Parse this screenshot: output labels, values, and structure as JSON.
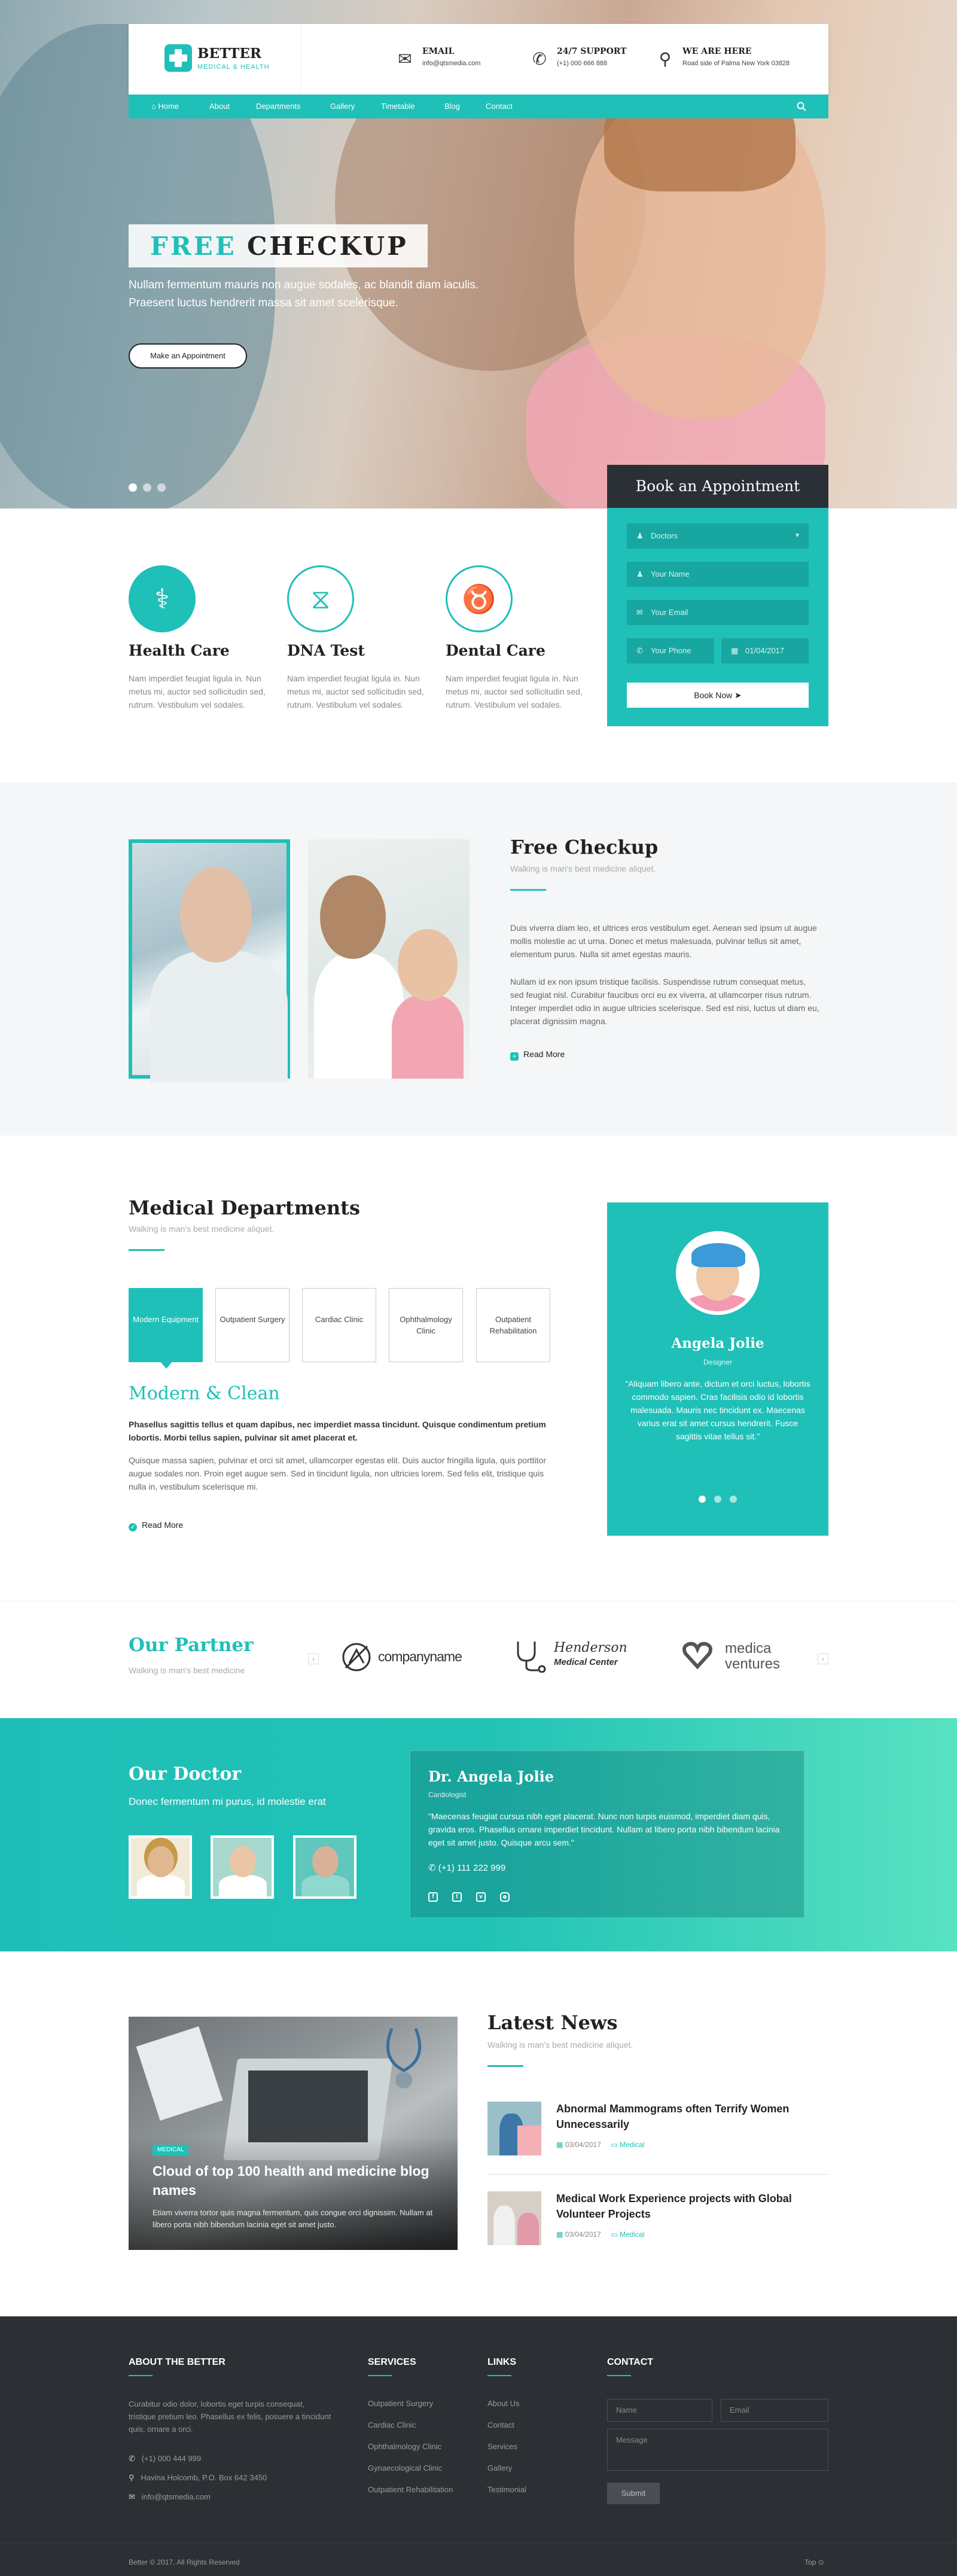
{
  "brand": {
    "name": "BETTER",
    "tagline": "MEDICAL & HEALTH"
  },
  "header_info": [
    {
      "icon": "envelope-icon",
      "glyph": "✉",
      "title": "EMAIL",
      "sub": "info@qtsmedia.com"
    },
    {
      "icon": "phone-icon",
      "glyph": "✆",
      "title": "24/7 SUPPORT",
      "sub": "(+1) 000 666 888"
    },
    {
      "icon": "map-pin-icon",
      "glyph": "⚲",
      "title": "WE ARE HERE",
      "sub": "Road side of Palma New York 03828"
    }
  ],
  "nav": {
    "items": [
      {
        "label": "Home",
        "icon": "⌂"
      },
      {
        "label": "About"
      },
      {
        "label": "Departments"
      },
      {
        "label": "Gallery"
      },
      {
        "label": "Timetable"
      },
      {
        "label": "Blog"
      },
      {
        "label": "Contact"
      }
    ],
    "search_icon": "search-icon"
  },
  "hero": {
    "title_accent": "FREE",
    "title_rest": "CHECKUP",
    "desc": "Nullam fermentum mauris non augue sodales, ac blandit diam iaculis. Praesent luctus hendrerit massa sit amet scelerisque.",
    "button": "Make an Appointment"
  },
  "appointment": {
    "title": "Book an Appointment",
    "doctors": "Doctors",
    "name_ph": "Your Name",
    "email_ph": "Your Email",
    "phone_ph": "Your Phone",
    "date": "01/04/2017",
    "button": "Book Now"
  },
  "services": [
    {
      "title": "Health Care",
      "icon": "stethoscope-icon",
      "desc": "Nam imperdiet feugiat ligula in. Nun metus mi, auctor sed sollicitudin sed, rutrum. Vestibulum vel sodales."
    },
    {
      "title": "DNA Test",
      "icon": "dna-icon",
      "desc": "Nam imperdiet feugiat ligula in. Nun metus mi, auctor sed sollicitudin sed, rutrum. Vestibulum vel sodales."
    },
    {
      "title": "Dental Care",
      "icon": "tooth-icon",
      "desc": "Nam imperdiet feugiat ligula in. Nun metus mi, auctor sed sollicitudin sed, rutrum. Vestibulum vel sodales."
    }
  ],
  "checkup": {
    "title": "Free Checkup",
    "sub": "Walking is man's best medicine aliquet.",
    "p1": "Duis viverra diam leo, et ultrices eros vestibulum eget. Aenean sed ipsum ut augue mollis molestie ac ut urna. Donec et metus malesuada, pulvinar tellus sit amet, elementum purus. Nulla sit amet egestas mauris.",
    "p2": "Nullam id ex non ipsum tristique facilisis. Suspendisse rutrum consequat metus, sed feugiat nisl. Curabitur faucibus orci eu ex viverra, at ullamcorper risus rutrum. Integer imperdiet odio in augue ultricies scelerisque. Sed est nisi, luctus ut diam eu, placerat dignissim magna.",
    "more": "Read More"
  },
  "departments": {
    "title": "Medical Departments",
    "sub": "Walking is man's best medicine aliquet.",
    "tabs": [
      "Modern Equipment",
      "Outpatient Surgery",
      "Cardiac Clinic",
      "Ophthalmology Clinic",
      "Outpatient Rehabilitation"
    ],
    "content_title": "Modern & Clean",
    "bold": "Phasellus sagittis tellus et quam dapibus, nec imperdiet massa tincidunt. Quisque condimentum pretium lobortis. Morbi tellus sapien, pulvinar sit amet placerat et.",
    "body": "Quisque massa sapien, pulvinar et orci sit amet, ullamcorper egestas elit. Duis auctor fringilla ligula, quis porttitor augue sodales non. Proin eget augue sem. Sed in tincidunt ligula, non ultricies lorem. Sed felis elit, tristique quis nulla in, vestibulum scelerisque mi.",
    "more": "Read More"
  },
  "testimonial": {
    "name": "Angela Jolie",
    "role": "Designer",
    "quote": "\"Aliquam libero ante, dictum et orci luctus, lobortis commodo sapien. Cras facilisis odio id lobortis malesuada. Mauris nec tincidunt ex. Maecenas varius erat sit amet cursus hendrerit. Fusce sagittis vitae tellus sit.\""
  },
  "partner": {
    "title": "Our Partner",
    "sub": "Walking is man's best medicine",
    "logos": [
      {
        "name": "companyname",
        "icon": "company-logo-icon"
      },
      {
        "name1": "Henderson",
        "name2": "Medical Center",
        "icon": "stethoscope-logo-icon"
      },
      {
        "name1": "medica",
        "name2": "ventures",
        "icon": "heart-logo-icon"
      }
    ]
  },
  "doctor": {
    "title": "Our Doctor",
    "sub": "Donec fermentum mi purus, id molestie erat",
    "name": "Dr. Angela Jolie",
    "role": "Cardiologist",
    "quote": "\"Maecenas feugiat cursus nibh eget placerat. Nunc non turpis euismod, imperdiet diam quis, gravida eros. Phasellus ornare imperdiet tincidunt. Nullam at libero porta nibh bibendum lacinia eget sit amet justo. Quisque arcu sem.\"",
    "phone": "(+1) 111 222 999",
    "socials": [
      "facebook-icon",
      "twitter-icon",
      "vimeo-icon",
      "instagram-icon"
    ]
  },
  "news": {
    "title": "Latest News",
    "sub": "Walking is man's best medicine aliquet.",
    "featured": {
      "tag": "MEDICAL",
      "title": "Cloud of top 100 health and medicine blog names",
      "desc": "Etiam viverra tortor quis magna fermentum, quis congue orci dignissim. Nullam at libero porta nibh bibendum lacinia eget sit amet justo."
    },
    "items": [
      {
        "title": "Abnormal Mammograms often Terrify Women Unnecessarily",
        "date": "03/04/2017",
        "cat": "Medical"
      },
      {
        "title": "Medical Work Experience projects with Global Volunteer Projects",
        "date": "03/04/2017",
        "cat": "Medical"
      }
    ]
  },
  "footer": {
    "about_title": "ABOUT THE BETTER",
    "about_text": "Curabitur odio dolor, lobortis eget turpis consequat, tristique pretium leo. Phasellus ex felis, posuere a tincidunt quis, ornare a orci.",
    "phone": "(+1) 000 444 999",
    "address": "Havina Holcomb, P.O. Box 642 3450",
    "email": "info@qtsmedia.com",
    "services_title": "SERVICES",
    "services": [
      "Outpatient Surgery",
      "Cardiac Clinic",
      "Ophthalmology Clinic",
      "Gynaecological Clinic",
      "Outpatient Rehabilitation"
    ],
    "links_title": "LINKS",
    "links": [
      "About Us",
      "Contact",
      "Services",
      "Gallery",
      "Testimonial"
    ],
    "contact_title": "CONTACT",
    "name_ph": "Name",
    "email_ph": "Email",
    "message_ph": "Message",
    "submit": "Submit",
    "copyright": "Better © 2017, All Rights Reserved",
    "top": "Top"
  },
  "colors": {
    "accent": "#1fc0b8",
    "dark": "#2c3035",
    "header_dark": "#2a3036"
  }
}
